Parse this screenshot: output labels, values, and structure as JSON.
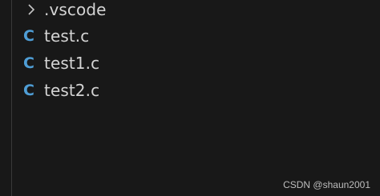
{
  "explorer": {
    "folder": {
      "name": ".vscode",
      "icon": "chevron-right-icon"
    },
    "files": [
      {
        "name": "test.c",
        "icon_letter": "C",
        "icon": "c-file-icon"
      },
      {
        "name": "test1.c",
        "icon_letter": "C",
        "icon": "c-file-icon"
      },
      {
        "name": "test2.c",
        "icon_letter": "C",
        "icon": "c-file-icon"
      }
    ]
  },
  "watermark": "CSDN @shaun2001",
  "colors": {
    "background": "#181818",
    "c_icon": "#4f9ed6",
    "text": "#d4d4d4"
  }
}
